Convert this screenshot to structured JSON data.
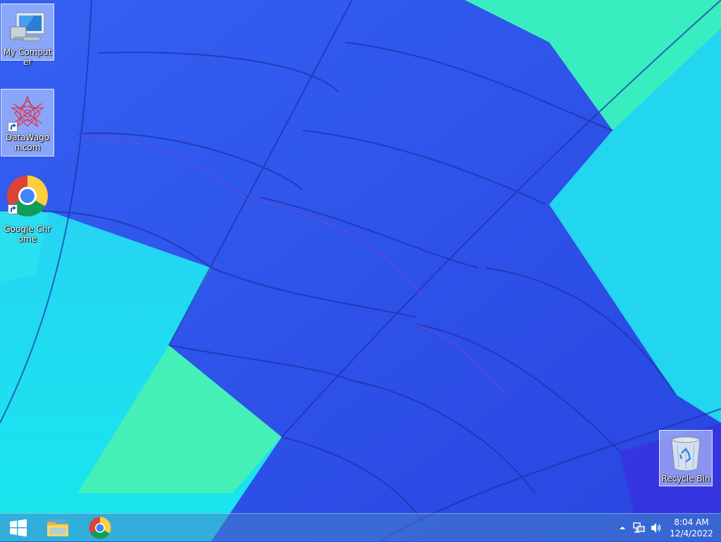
{
  "desktop": {
    "icons": [
      {
        "label": "My Computer",
        "icon": "computer-icon"
      },
      {
        "label": "DataWagon.com",
        "icon": "datawagon-icon"
      },
      {
        "label": "Google Chrome",
        "icon": "chrome-icon"
      },
      {
        "label": "Recycle Bin",
        "icon": "recycle-bin-icon"
      }
    ]
  },
  "taskbar": {
    "start_icon": "windows-start-icon",
    "pinned": [
      {
        "name": "File Explorer",
        "icon": "folder-icon"
      },
      {
        "name": "Google Chrome",
        "icon": "chrome-icon"
      }
    ],
    "tray": {
      "show_hidden_icon": "chevron-up-icon",
      "network_icon": "network-icon",
      "volume_icon": "speaker-icon",
      "time": "8:04 AM",
      "date": "12/4/2022"
    }
  },
  "colors": {
    "wallpaper_blue": "#2b55e8",
    "wallpaper_cyan": "#1fe0f0",
    "wallpaper_green": "#3ff0a0",
    "taskbar": "#4682c8"
  }
}
